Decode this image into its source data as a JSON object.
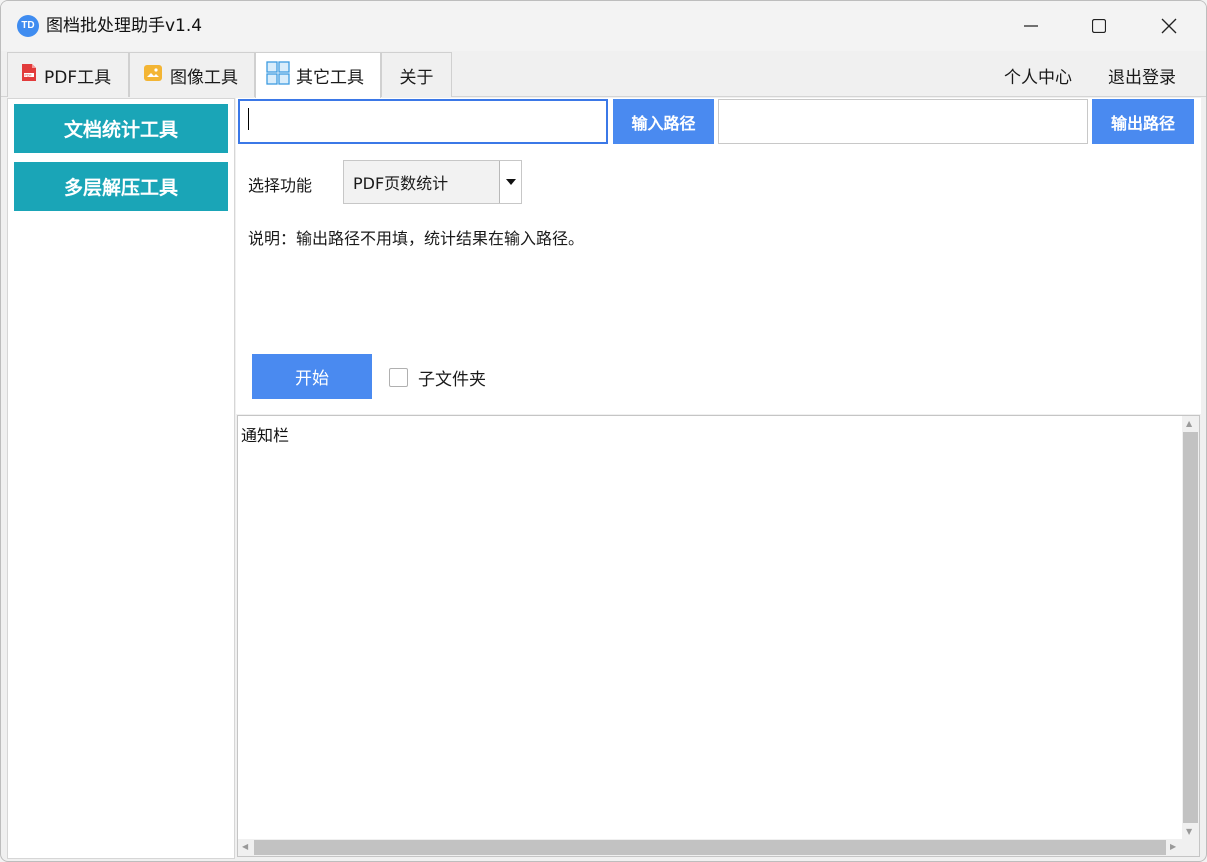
{
  "window": {
    "app_icon_text": "TD",
    "title": "图档批处理助手v1.4"
  },
  "tabs": [
    {
      "label": "PDF工具",
      "icon": "pdf-file-icon"
    },
    {
      "label": "图像工具",
      "icon": "image-icon"
    },
    {
      "label": "其它工具",
      "icon": "grid-icon",
      "active": true
    },
    {
      "label": "关于"
    }
  ],
  "top_links": {
    "profile": "个人中心",
    "logout": "退出登录"
  },
  "sidebar": {
    "items": [
      {
        "label": "文档统计工具"
      },
      {
        "label": "多层解压工具"
      }
    ]
  },
  "paths": {
    "input_value": "",
    "input_button": "输入路径",
    "output_value": "",
    "output_button": "输出路径"
  },
  "function": {
    "label": "选择功能",
    "selected": "PDF页数统计"
  },
  "hint": "说明：输出路径不用填，统计结果在输入路径。",
  "actions": {
    "start": "开始",
    "subfolder_label": "子文件夹",
    "subfolder_checked": false
  },
  "notice": {
    "text": "通知栏"
  },
  "colors": {
    "sidebar_button": "#1aa5b7",
    "primary_button": "#4a8af0",
    "focus_border": "#3b78e7"
  }
}
